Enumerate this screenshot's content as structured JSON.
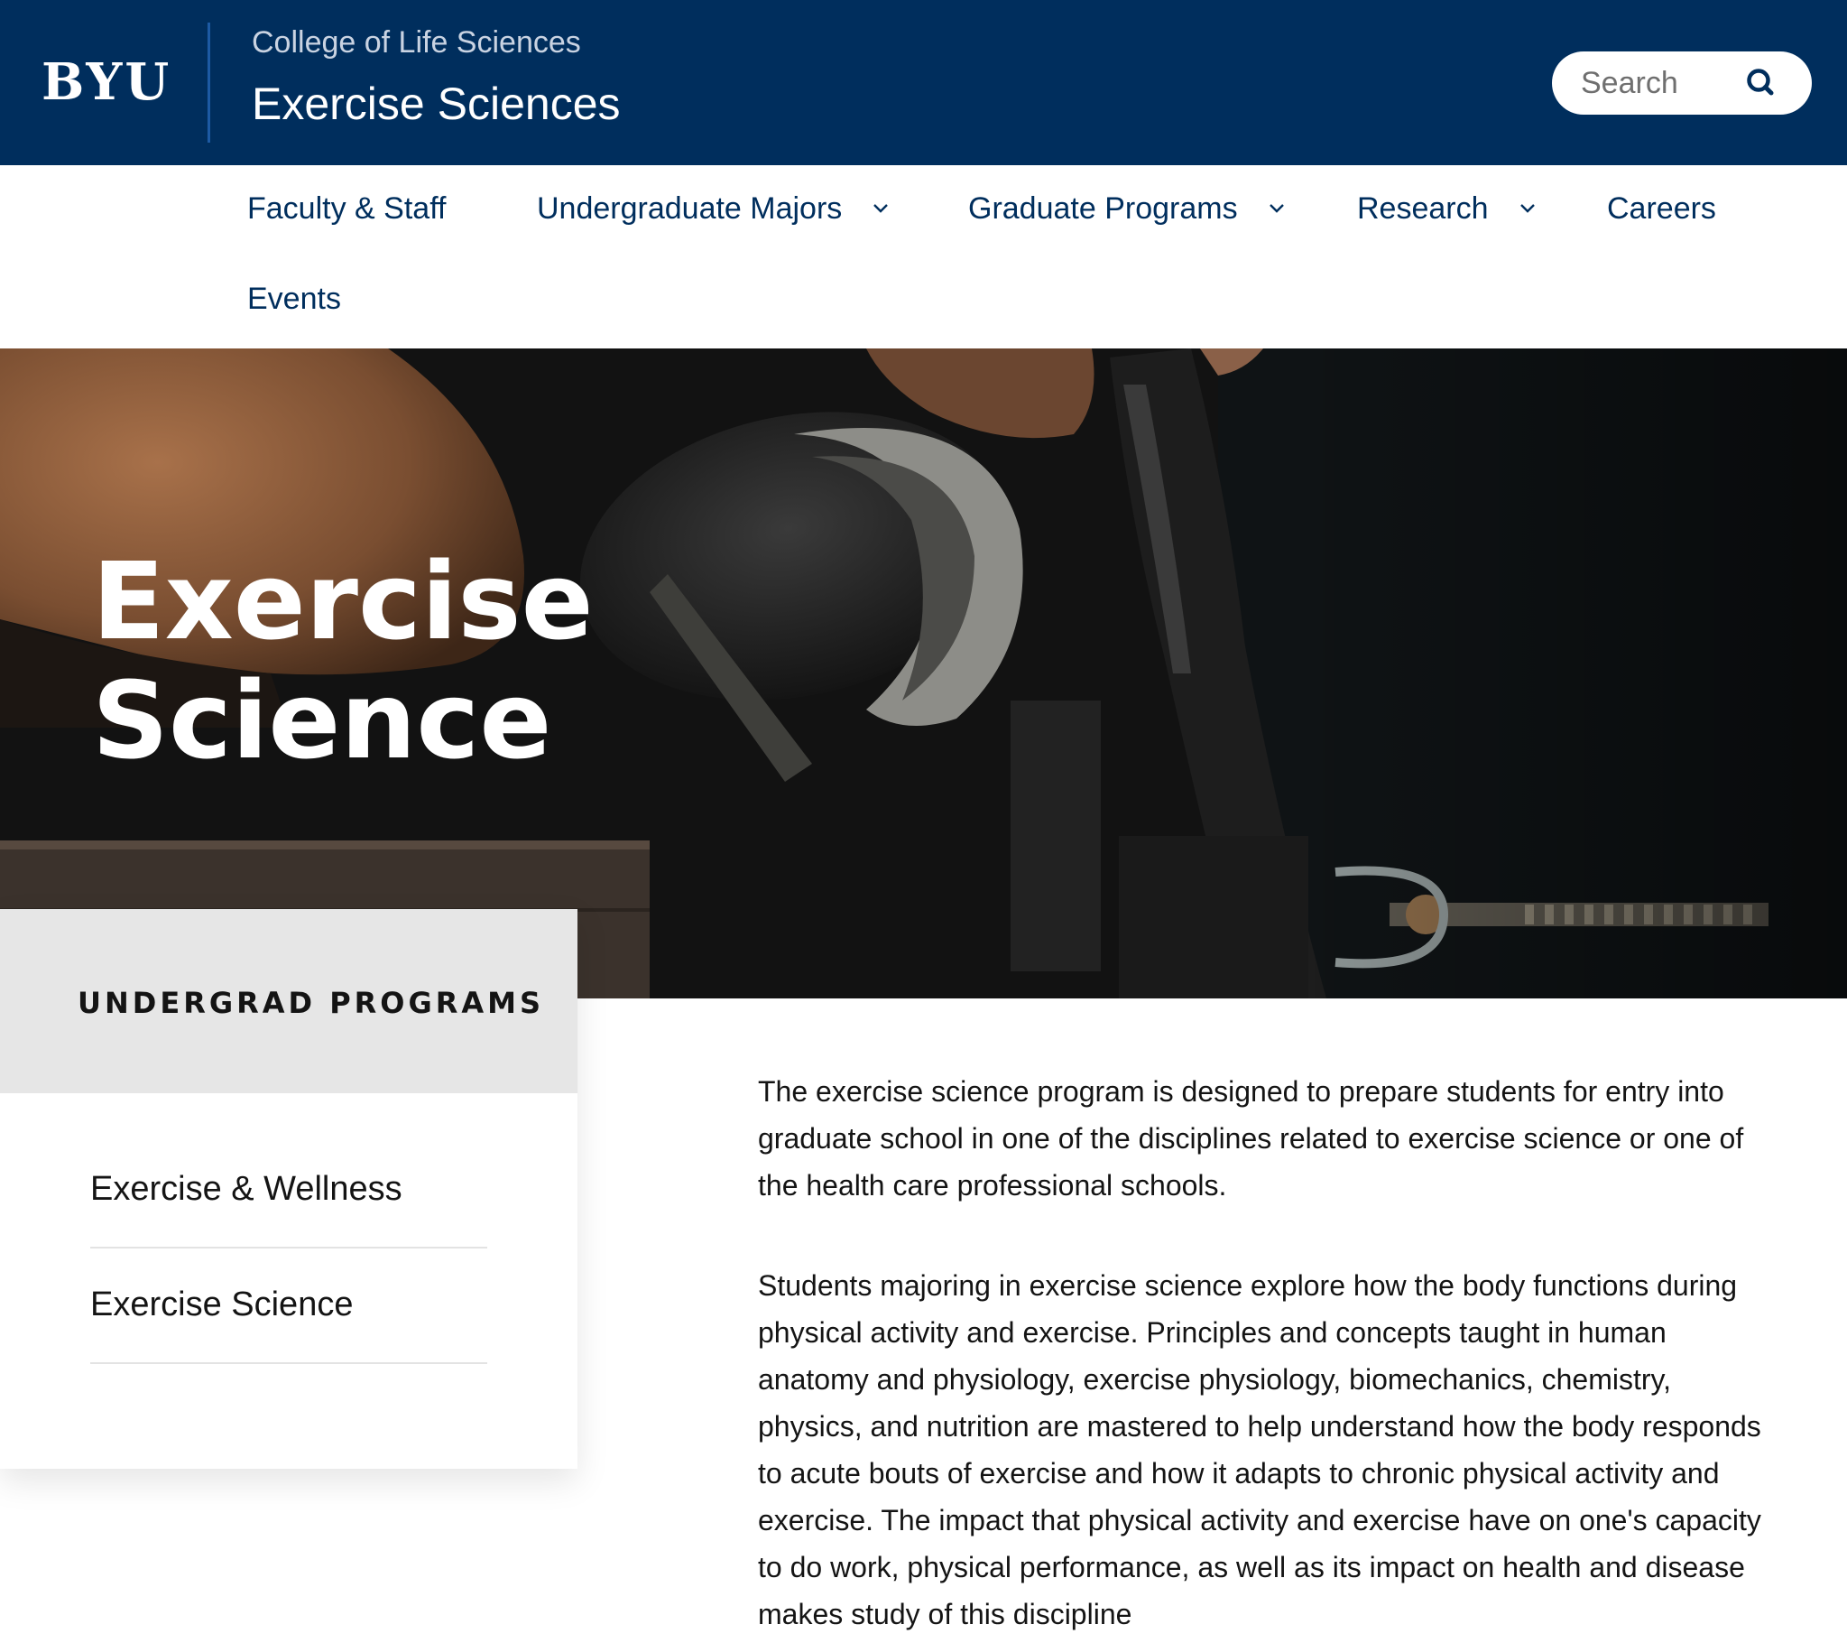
{
  "header": {
    "logo": "BYU",
    "college": "College of Life Sciences",
    "site_title": "Exercise Sciences",
    "search_placeholder": "Search",
    "background_color": "#002e5d"
  },
  "nav": {
    "items": [
      {
        "label": "Faculty & Staff",
        "has_dropdown": false
      },
      {
        "label": "Undergraduate Majors",
        "has_dropdown": true
      },
      {
        "label": "Graduate Programs",
        "has_dropdown": true
      },
      {
        "label": "Research",
        "has_dropdown": true
      },
      {
        "label": "Careers",
        "has_dropdown": false
      },
      {
        "label": "Events",
        "has_dropdown": false
      }
    ]
  },
  "hero": {
    "title_line1": "Exercise",
    "title_line2": "Science"
  },
  "sidebar": {
    "heading": "UNDERGRAD PROGRAMS",
    "links": [
      {
        "label": "Exercise & Wellness"
      },
      {
        "label": "Exercise Science"
      }
    ]
  },
  "content": {
    "paragraphs": [
      "The exercise science program is designed to prepare students for entry into graduate school in one of the disciplines related to exercise science or one of the health care professional schools.",
      "Students majoring in exercise science explore how the body functions during physical activity and exercise. Principles and concepts taught in human anatomy and physiology, exercise physiology, biomechanics, chemistry, physics, and nutrition are mastered to help understand how the body responds to acute bouts of exercise and how it adapts to chronic physical activity and exercise. The impact that physical activity and exercise have on one's capacity to do work, physical performance, as well as its impact on health and disease makes study of this discipline"
    ]
  },
  "icons": {
    "search": "search-icon",
    "dropdown": "chevron-down-icon"
  }
}
